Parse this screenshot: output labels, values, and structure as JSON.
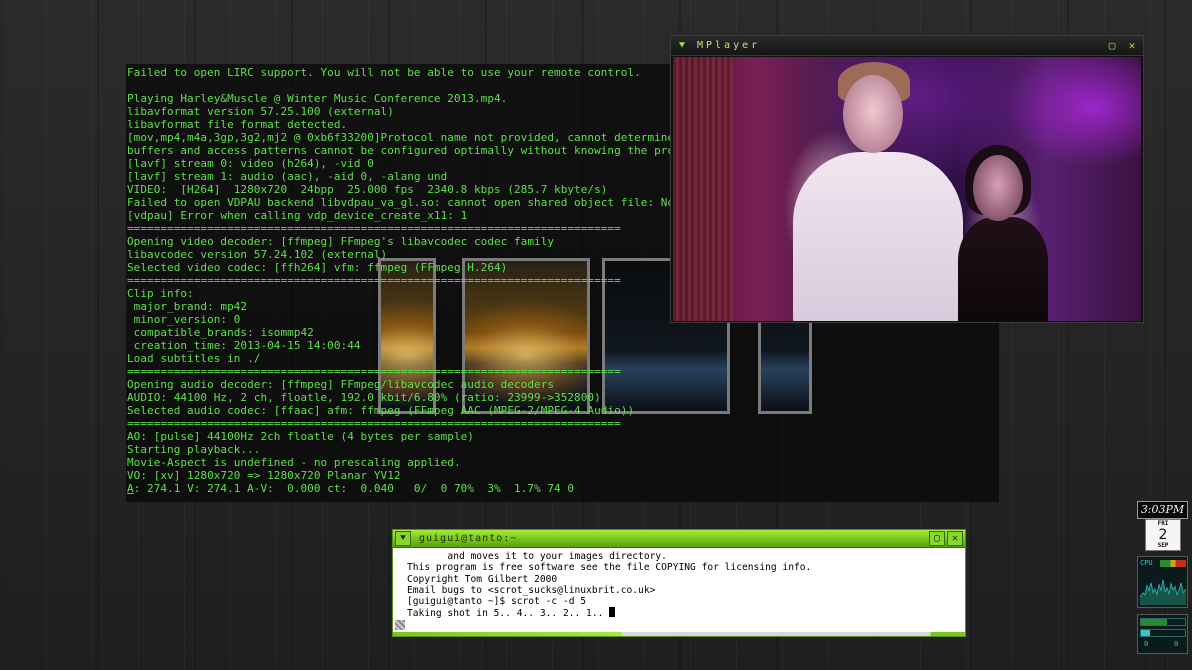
{
  "terminal": {
    "lines": [
      "Failed to open LIRC support. You will not be able to use your remote control.",
      "",
      "Playing Harley&Muscle @ Winter Music Conference 2013.mp4.",
      "libavformat version 57.25.100 (external)",
      "libavformat file format detected.",
      "[mov,mp4,m4a,3gp,3g2,mj2 @ 0xb6f33200]Protocol name not provided, cannot determine if input is local or a network protocol,",
      "buffers and access patterns cannot be configured optimally without knowing the protocol",
      "[lavf] stream 0: video (h264), -vid 0",
      "[lavf] stream 1: audio (aac), -aid 0, -alang und",
      "VIDEO:  [H264]  1280x720  24bpp  25.000 fps  2340.8 kbps (285.7 kbyte/s)",
      "Failed to open VDPAU backend libvdpau_va_gl.so: cannot open shared object file: No such file or directory",
      "[vdpau] Error when calling vdp_device_create_x11: 1",
      "==========================================================================",
      "Opening video decoder: [ffmpeg] FFmpeg's libavcodec codec family",
      "libavcodec version 57.24.102 (external)",
      "Selected video codec: [ffh264] vfm: ffmpeg (FFmpeg H.264)",
      "==========================================================================",
      "Clip info:",
      " major_brand: mp42",
      " minor_version: 0",
      " compatible_brands: isommp42",
      " creation_time: 2013-04-15 14:00:44",
      "Load subtitles in ./",
      "==========================================================================",
      "Opening audio decoder: [ffmpeg] FFmpeg/libavcodec audio decoders",
      "AUDIO: 44100 Hz, 2 ch, floatle, 192.0 kbit/6.80% (ratio: 23999->352800)",
      "Selected audio codec: [ffaac] afm: ffmpeg (FFmpeg AAC (MPEG-2/MPEG-4 Audio))",
      "==========================================================================",
      "AO: [pulse] 44100Hz 2ch floatle (4 bytes per sample)",
      "Starting playback...",
      "Movie-Aspect is undefined - no prescaling applied.",
      "VO: [xv] 1280x720 => 1280x720 Planar YV12"
    ],
    "status_prefix": "A",
    "status_rest": ": 274.1 V: 274.1 A-V:  0.000 ct:  0.040   0/  0 70%  3%  1.7% 74 0",
    "text_color": "#5fe04a"
  },
  "mplayer": {
    "title": "MPlayer",
    "menu_icon": "chevron-down-icon",
    "maximize_icon": "maximize-icon",
    "close_icon": "close-icon"
  },
  "xterm": {
    "title": "guigui@tanto:~",
    "lines": [
      "       and moves it to your images directory.",
      "",
      "This program is free software see the file COPYING for licensing info.",
      "Copyright Tom Gilbert 2000",
      "Email bugs to <scrot_sucks@linuxbrit.co.uk>",
      "[guigui@tanto ~]$ scrot -c -d 5",
      "Taking shot in 5.. 4.. 3.. 2.. 1.. "
    ],
    "accent_color": "#8ad630"
  },
  "dock": {
    "clock": "3:03PM",
    "calendar": {
      "weekday": "FRI",
      "day": "2",
      "month": "SEP"
    },
    "cpu_label": "CPU",
    "mem_labels": [
      "0",
      "0"
    ]
  }
}
